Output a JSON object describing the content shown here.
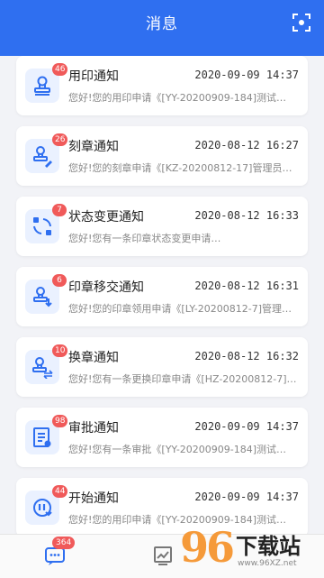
{
  "header": {
    "title": "消息"
  },
  "notifications": [
    {
      "title": "用印通知",
      "count": "46",
      "time": "2020-09-09 14:37",
      "preview": "您好!您的用印申请《[YY-20200909-184]测试…",
      "icon": "stamp-icon"
    },
    {
      "title": "刻章通知",
      "count": "26",
      "time": "2020-08-12 16:27",
      "preview": "您好!您的刻章申请《[KZ-20200812-17]管理员…",
      "icon": "stamp-carve-icon"
    },
    {
      "title": "状态变更通知",
      "count": "7",
      "time": "2020-08-12 16:33",
      "preview": "您好!您有一条印章状态变更申请…",
      "icon": "status-change-icon"
    },
    {
      "title": "印章移交通知",
      "count": "6",
      "time": "2020-08-12 16:31",
      "preview": "您好!您的印章领用申请《[LY-20200812-7]管理…",
      "icon": "stamp-transfer-icon"
    },
    {
      "title": "换章通知",
      "count": "10",
      "time": "2020-08-12 16:32",
      "preview": "您好!您有一条更换印章申请《[HZ-20200812-7]…",
      "icon": "stamp-exchange-icon"
    },
    {
      "title": "审批通知",
      "count": "98",
      "time": "2020-09-09 14:37",
      "preview": "您好!您有一条审批《[YY-20200909-184]测试…",
      "icon": "approval-icon"
    },
    {
      "title": "开始通知",
      "count": "44",
      "time": "2020-09-09 14:37",
      "preview": "您好!您的用印申请《[YY-20200909-184]测试…",
      "icon": "start-icon"
    }
  ],
  "tabbar": {
    "message_badge": "364"
  },
  "watermark": {
    "digits": "96",
    "text": "下载站",
    "url": "www.96XZ.net"
  },
  "colors": {
    "accent": "#2f6ff0",
    "badge": "#f05a5a",
    "watermark": "#f59a3a"
  }
}
